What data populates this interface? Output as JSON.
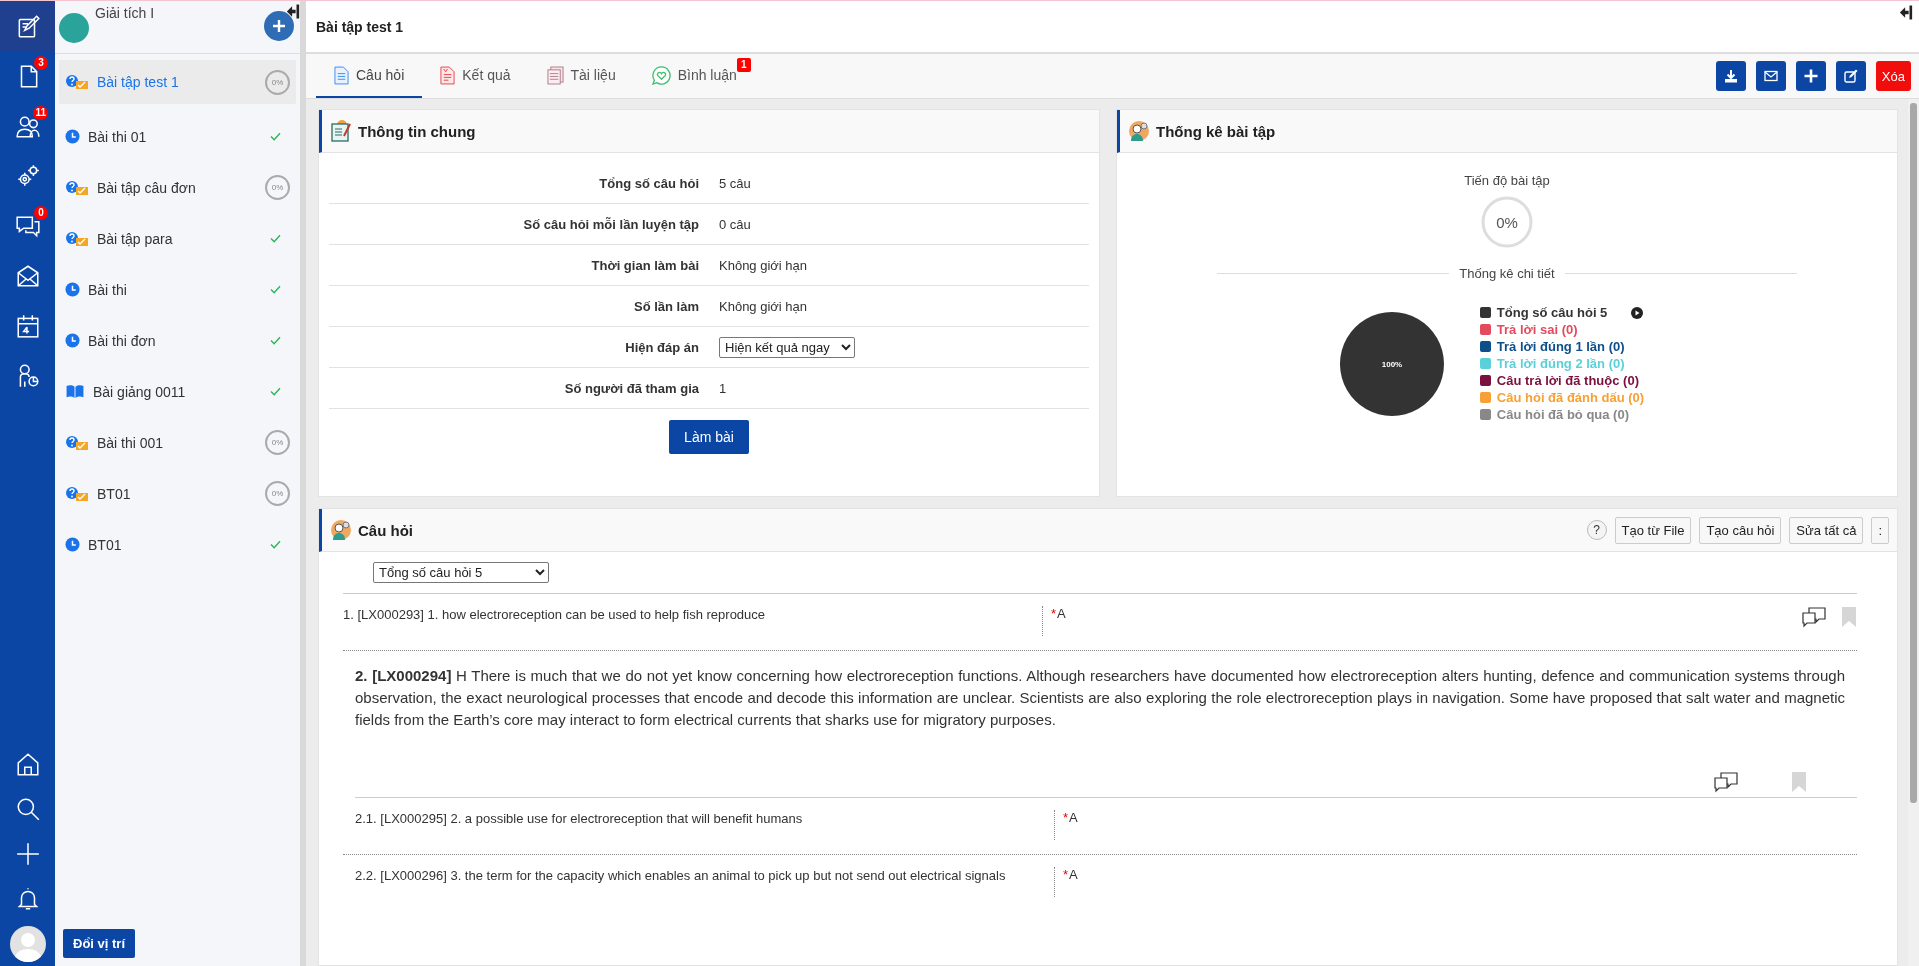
{
  "rail": {
    "items": [
      {
        "kind": "edit",
        "selected": true
      },
      {
        "kind": "document",
        "selected": false,
        "badge": "3"
      },
      {
        "kind": "users",
        "selected": false,
        "badge": "11"
      },
      {
        "kind": "gears",
        "selected": false
      },
      {
        "kind": "chat",
        "selected": false,
        "badge": "0"
      },
      {
        "kind": "mail",
        "selected": false
      },
      {
        "kind": "calendar",
        "selected": false
      },
      {
        "kind": "person-chart",
        "selected": false
      }
    ],
    "bottom": [
      {
        "kind": "home"
      },
      {
        "kind": "search"
      },
      {
        "kind": "plus"
      },
      {
        "kind": "bell"
      },
      {
        "kind": "avatar"
      }
    ]
  },
  "sidebar": {
    "course": "Giải tích I",
    "items": [
      {
        "kind": "exercise",
        "label": "Bài tập test 1",
        "selected": true,
        "completed": false,
        "progress": "0%"
      },
      {
        "kind": "exam",
        "label": "Bài thi 01",
        "selected": false,
        "completed": true
      },
      {
        "kind": "exercise",
        "label": "Bài tập câu đơn",
        "selected": false,
        "completed": false,
        "progress": "0%"
      },
      {
        "kind": "exercise",
        "label": "Bài tập para",
        "selected": false,
        "completed": true
      },
      {
        "kind": "exam",
        "label": "Bài thi",
        "selected": false,
        "completed": true
      },
      {
        "kind": "exam",
        "label": "Bài thi đơn",
        "selected": false,
        "completed": true
      },
      {
        "kind": "lecture",
        "label": "Bài giảng 0011",
        "selected": false,
        "completed": true
      },
      {
        "kind": "exercise",
        "label": "Bài thi 001",
        "selected": false,
        "completed": false,
        "progress": "0%"
      },
      {
        "kind": "exercise",
        "label": "BT01",
        "selected": false,
        "completed": false,
        "progress": "0%"
      },
      {
        "kind": "exam",
        "label": "BT01",
        "selected": false,
        "completed": true
      }
    ],
    "swap_button": "Đổi vị trí"
  },
  "title": "Bài tập test 1",
  "tabs": [
    {
      "kind": "page",
      "label": "Câu hỏi",
      "selected": true
    },
    {
      "kind": "report",
      "label": "Kết quả",
      "selected": false
    },
    {
      "kind": "pages",
      "label": "Tài liệu",
      "selected": false
    },
    {
      "kind": "heart-bubble",
      "label": "Bình luận",
      "selected": false,
      "badge": "1"
    }
  ],
  "toolbar": [
    {
      "kind": "download"
    },
    {
      "kind": "mail"
    },
    {
      "kind": "plus"
    },
    {
      "kind": "edit"
    },
    {
      "kind": "danger",
      "label": "Xóa"
    }
  ],
  "info_panel": {
    "title": "Thông tin chung",
    "rows": [
      {
        "kind": "text",
        "label": "Tổng số câu hỏi",
        "value": "5 câu"
      },
      {
        "kind": "text",
        "label": "Số câu hỏi mỗi lần luyện tập",
        "value": "0 câu"
      },
      {
        "kind": "text",
        "label": "Thời gian làm bài",
        "value": "Không giới hạn"
      },
      {
        "kind": "text",
        "label": "Số lần làm",
        "value": "Không giới hạn"
      },
      {
        "kind": "select",
        "label": "Hiện đáp án",
        "value": "Hiện kết quả ngay"
      },
      {
        "kind": "text",
        "label": "Số người đã tham gia",
        "value": "1"
      }
    ],
    "button": "Làm bài"
  },
  "stats_panel": {
    "title": "Thống kê bài tập",
    "progress_label": "Tiến độ bài tập",
    "progress": {
      "text": "0%",
      "level": 0
    },
    "detail_label": "Thống kê chi tiết",
    "chart_data": {
      "type": "pie",
      "values": [
        100,
        0,
        0,
        0,
        0,
        0,
        0
      ],
      "value_labels": [
        "100%",
        null,
        null,
        null,
        null,
        null,
        null
      ]
    },
    "legend": [
      {
        "label": "Tổng số câu hỏi 5",
        "color": "#333333",
        "has_play": true
      },
      {
        "label": "Trả lời sai (0)",
        "color": "#e34a5e",
        "has_play": false
      },
      {
        "label": "Trả lời đúng 1 lần (0)",
        "color": "#0d4f8b",
        "has_play": false
      },
      {
        "label": "Trả lời đúng 2 lần (0)",
        "color": "#5bd0d8",
        "has_play": false
      },
      {
        "label": "Câu trả lời đã thuộc (0)",
        "color": "#7b0f3e",
        "has_play": false
      },
      {
        "label": "Câu hỏi đã đánh dấu (0)",
        "color": "#f7a035",
        "has_play": false
      },
      {
        "label": "Câu hỏi đã bỏ qua (0)",
        "color": "#888888",
        "has_play": false
      }
    ]
  },
  "questions_panel": {
    "title": "Câu hỏi",
    "help": "?",
    "buttons": [
      "Tạo từ File",
      "Tạo câu hỏi",
      "Sửa tất cả"
    ],
    "more": ":",
    "filter": "Tổng số câu hỏi 5",
    "items": [
      {
        "kind": "question",
        "text": "1. [LX000293] 1. how electroreception can be used to help fish reproduce",
        "mark": "*",
        "answer": "A"
      },
      {
        "kind": "passage",
        "text": "**2. [LX000294]** H There is much that we do not yet know concerning how electroreception functions. Although researchers have documented how electroreception alters hunting, defence and communication systems through observation, the exact neurological processes that encode and decode this information are unclear. Scientists are also exploring the role electroreception plays in navigation. Some have proposed that salt water and magnetic fields from the Earth’s core may interact to form electrical currents that sharks use for migratory purposes.",
        "children": [
          {
            "kind": "question",
            "text": "2.1. [LX000295] 2. a possible use for electroreception that will benefit humans",
            "mark": "*",
            "answer": "A"
          },
          {
            "kind": "question",
            "text": "2.2. [LX000296] 3. the term for the capacity which enables an animal to pick up but not send out electrical signals",
            "mark": "*",
            "answer": "A"
          }
        ]
      }
    ]
  }
}
